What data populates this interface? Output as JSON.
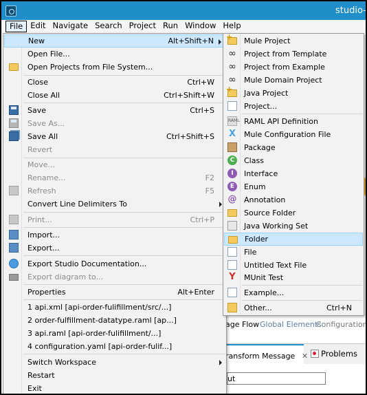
{
  "window": {
    "title": "studio-w"
  },
  "menubar": [
    "File",
    "Edit",
    "Navigate",
    "Search",
    "Project",
    "Run",
    "Window",
    "Help"
  ],
  "file_menu": {
    "items": [
      {
        "label": "New",
        "shortcut": "Alt+Shift+N",
        "submenu": true,
        "highlighted": true
      },
      {
        "label": "Open File..."
      },
      {
        "label": "Open Projects from File System...",
        "icon": "folder-icon"
      },
      {
        "label": "Close",
        "shortcut": "Ctrl+W"
      },
      {
        "label": "Close All",
        "shortcut": "Ctrl+Shift+W"
      },
      {
        "label": "Save",
        "shortcut": "Ctrl+S",
        "icon": "save-icon"
      },
      {
        "label": "Save As...",
        "disabled": true,
        "icon": "save-as-icon"
      },
      {
        "label": "Save All",
        "shortcut": "Ctrl+Shift+S",
        "icon": "save-all-icon"
      },
      {
        "label": "Revert",
        "disabled": true
      },
      {
        "label": "Move...",
        "disabled": true
      },
      {
        "label": "Rename...",
        "shortcut": "F2",
        "disabled": true
      },
      {
        "label": "Refresh",
        "shortcut": "F5",
        "disabled": true,
        "icon": "refresh-icon"
      },
      {
        "label": "Convert Line Delimiters To",
        "submenu": true
      },
      {
        "label": "Print...",
        "shortcut": "Ctrl+P",
        "disabled": true,
        "icon": "print-icon"
      },
      {
        "label": "Import...",
        "icon": "import-icon"
      },
      {
        "label": "Export...",
        "icon": "export-icon"
      },
      {
        "label": "Export Studio Documentation...",
        "icon": "globe-icon"
      },
      {
        "label": "Export diagram to...",
        "disabled": true,
        "icon": "camera-icon"
      },
      {
        "label": "Properties",
        "shortcut": "Alt+Enter"
      },
      {
        "label": "1 api.xml  [api-order-fulifillment/src/...]"
      },
      {
        "label": "2 order-fulfillment-datatype.raml  [ap...]"
      },
      {
        "label": "3 api.raml  [api-order-fulifillment/...]"
      },
      {
        "label": "4 configuration.yaml  [api-order-fulif...]"
      },
      {
        "label": "Switch Workspace",
        "submenu": true
      },
      {
        "label": "Restart"
      },
      {
        "label": "Exit"
      }
    ]
  },
  "new_menu": {
    "items": [
      {
        "label": "Mule Project"
      },
      {
        "label": "Project from Template"
      },
      {
        "label": "Project from Example"
      },
      {
        "label": "Mule Domain Project"
      },
      {
        "label": "Java Project"
      },
      {
        "label": "Project..."
      },
      {
        "label": "RAML API Definition"
      },
      {
        "label": "Mule Configuration File"
      },
      {
        "label": "Package"
      },
      {
        "label": "Class"
      },
      {
        "label": "Interface"
      },
      {
        "label": "Enum"
      },
      {
        "label": "Annotation"
      },
      {
        "label": "Source Folder"
      },
      {
        "label": "Java Working Set"
      },
      {
        "label": "Folder",
        "highlighted": true
      },
      {
        "label": "File"
      },
      {
        "label": "Untitled Text File"
      },
      {
        "label": "MUnit Test"
      },
      {
        "label": "Example..."
      },
      {
        "label": "Other...",
        "shortcut": "Ctrl+N"
      }
    ]
  },
  "background": {
    "tabs_top": [
      "age Flow",
      "Global Elements",
      "Configuration X"
    ],
    "tab_transform": "ransform Message",
    "tab_close": "✕",
    "tab_problems": "Problems",
    "input_value": "ut"
  },
  "colors": {
    "titlebar": "#1f8ec9",
    "highlight": "#cce8ff",
    "highlight_border": "#99d1ff"
  }
}
